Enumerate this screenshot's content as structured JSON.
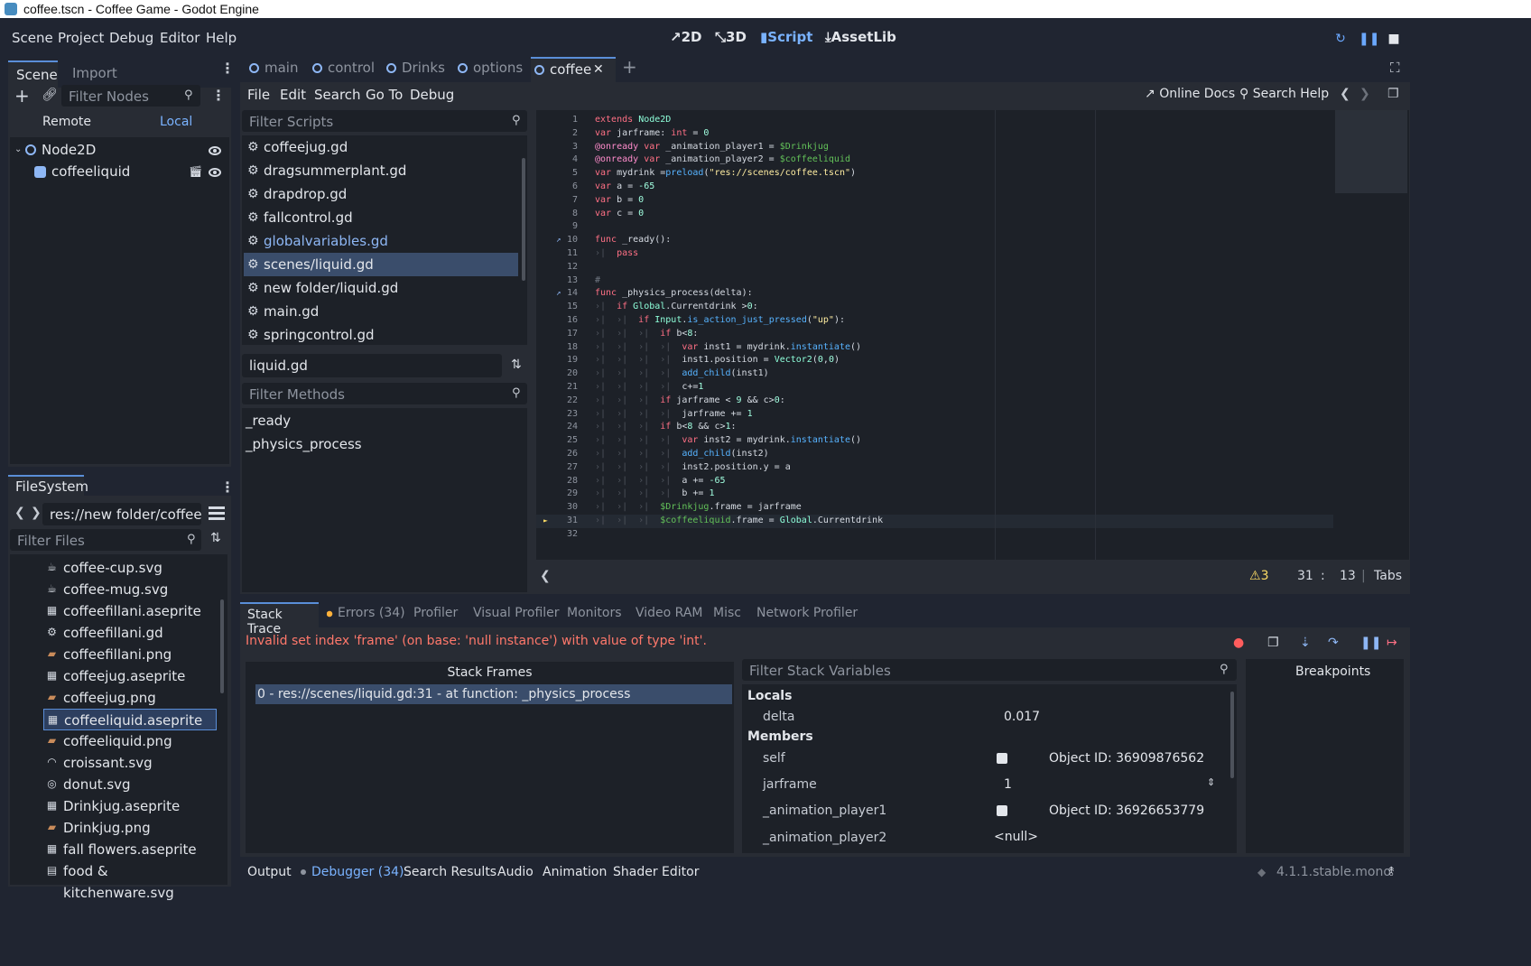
{
  "window_title": "coffee.tscn - Coffee Game - Godot Engine",
  "menu": [
    "Scene",
    "Project",
    "Debug",
    "Editor",
    "Help"
  ],
  "workspaces": {
    "w2d": "2D",
    "w3d": "3D",
    "script": "Script",
    "assetlib": "AssetLib"
  },
  "scene_dock": {
    "tabs": {
      "scene": "Scene",
      "import": "Import"
    },
    "filter_placeholder": "Filter Nodes",
    "remote": "Remote",
    "local": "Local",
    "nodes": [
      "Node2D",
      "coffeeliquid"
    ]
  },
  "filesystem": {
    "title": "FileSystem",
    "path": "res://new folder/coffeeliqui",
    "filter_placeholder": "Filter Files",
    "files": [
      {
        "name": "coffee-cup.svg",
        "icon": "cup-icon"
      },
      {
        "name": "coffee-mug.svg",
        "icon": "mug-icon"
      },
      {
        "name": "coffeefillani.aseprite",
        "icon": "sprite-icon"
      },
      {
        "name": "coffeefillani.gd",
        "icon": "gear-icon"
      },
      {
        "name": "coffeefillani.png",
        "icon": "image-icon"
      },
      {
        "name": "coffeejug.aseprite",
        "icon": "sprite-icon"
      },
      {
        "name": "coffeejug.png",
        "icon": "image-icon"
      },
      {
        "name": "coffeeliquid.aseprite",
        "icon": "sprite-icon"
      },
      {
        "name": "coffeeliquid.png",
        "icon": "image-icon"
      },
      {
        "name": "croissant.svg",
        "icon": "croissant-icon"
      },
      {
        "name": "donut.svg",
        "icon": "donut-icon"
      },
      {
        "name": "Drinkjug.aseprite",
        "icon": "sprite-icon"
      },
      {
        "name": "Drinkjug.png",
        "icon": "image-icon"
      },
      {
        "name": "fall flowers.aseprite",
        "icon": "sprite-icon"
      },
      {
        "name": "food & kitchenware.svg",
        "icon": "svg-icon"
      }
    ]
  },
  "script_tabs": [
    "main",
    "control",
    "Drinks",
    "options",
    "coffee"
  ],
  "script_menu": [
    "File",
    "Edit",
    "Search",
    "Go To",
    "Debug"
  ],
  "script_help": {
    "docs": "Online Docs",
    "search": "Search Help"
  },
  "scripts": {
    "filter_placeholder": "Filter Scripts",
    "list": [
      "coffeejug.gd",
      "dragsummerplant.gd",
      "drapdrop.gd",
      "fallcontrol.gd",
      "globalvariables.gd",
      "scenes/liquid.gd",
      "new folder/liquid.gd",
      "main.gd",
      "springcontrol.gd"
    ],
    "current": "liquid.gd",
    "methods_placeholder": "Filter Methods",
    "methods": [
      "_ready",
      "_physics_process"
    ]
  },
  "code_lines": [
    "extends Node2D",
    "var jarframe: int = 0",
    "@onready var _animation_player1 = $Drinkjug",
    "@onready var _animation_player2 = $coffeeliquid",
    "var mydrink =preload(\"res://scenes/coffee.tscn\")",
    "var a = -65",
    "var b = 0",
    "var c = 0",
    "",
    "func _ready():",
    "    pass",
    "",
    "#",
    "func _physics_process(delta):",
    "    if Global.Currentdrink >0:",
    "        if Input.is_action_just_pressed(\"up\"):",
    "            if b<8:",
    "                var inst1 = mydrink.instantiate()",
    "                inst1.position = Vector2(0,0)",
    "                add_child(inst1)",
    "                c+=1",
    "            if jarframe < 9 && c>0:",
    "                jarframe += 1",
    "            if b<8 && c>1:",
    "                var inst2 = mydrink.instantiate()",
    "                add_child(inst2)",
    "                inst2.position.y = a",
    "                a += -65",
    "                b += 1",
    "            $Drinkjug.frame = jarframe",
    "            $coffeeliquid.frame = Global.Currentdrink",
    ""
  ],
  "editor_status": {
    "warnings": "3",
    "line": "31",
    "col": "13",
    "indent": "Tabs"
  },
  "debugger": {
    "tabs": [
      "Stack Trace",
      "Errors (34)",
      "Profiler",
      "Visual Profiler",
      "Monitors",
      "Video RAM",
      "Misc",
      "Network Profiler"
    ],
    "error": "Invalid set index 'frame' (on base: 'null instance') with value of type 'int'.",
    "stack_frames_title": "Stack Frames",
    "stack_frame": "0 - res://scenes/liquid.gd:31 - at function: _physics_process",
    "filter_vars_placeholder": "Filter Stack Variables",
    "locals_label": "Locals",
    "members_label": "Members",
    "locals": [
      {
        "name": "delta",
        "value": "0.017"
      }
    ],
    "members": [
      {
        "name": "self",
        "value": "Object ID: 36909876562"
      },
      {
        "name": "jarframe",
        "value": "1"
      },
      {
        "name": "_animation_player1",
        "value": "Object ID: 36926653779"
      },
      {
        "name": "_animation_player2",
        "value": "<null>"
      }
    ],
    "breakpoints_title": "Breakpoints"
  },
  "bottom_panel": [
    "Output",
    "Debugger (34)",
    "Search Results",
    "Audio",
    "Animation",
    "Shader Editor"
  ],
  "version": "4.1.1.stable.mono",
  "colors": {
    "accent": "#5a8ed8",
    "error": "#ff786b",
    "bg": "#202531",
    "panel": "#282c34"
  }
}
